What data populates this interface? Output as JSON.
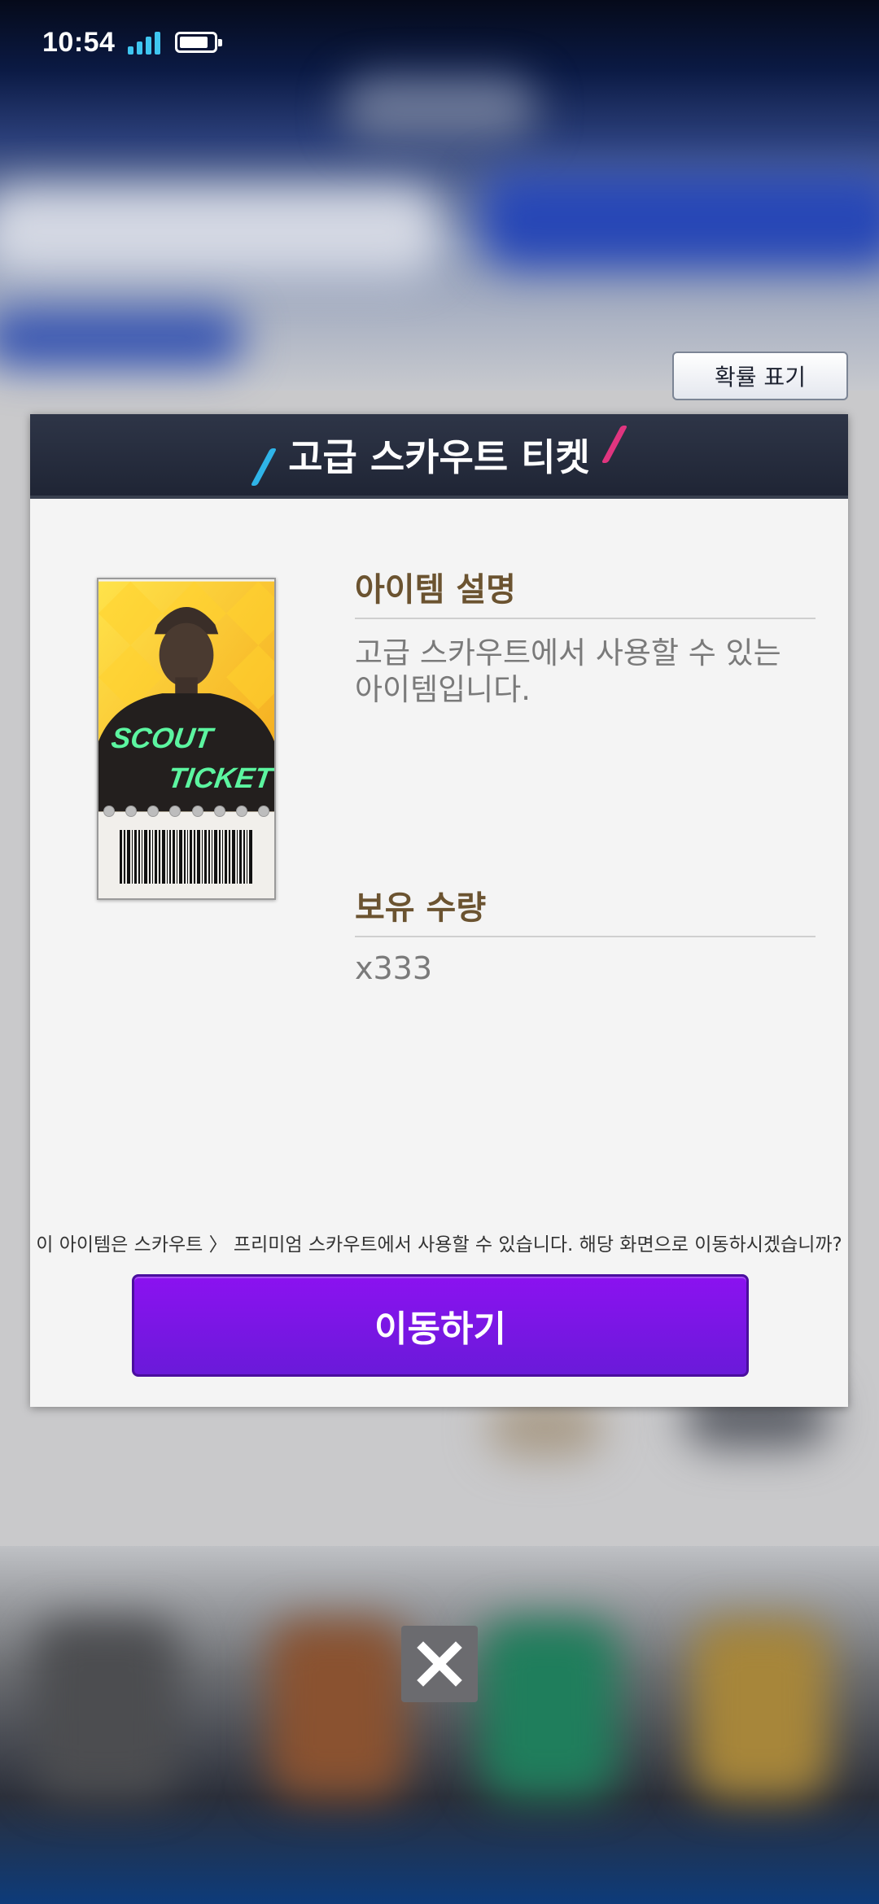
{
  "status_bar": {
    "time": "10:54"
  },
  "toolbar": {
    "probability_label": "확률 표기"
  },
  "dialog": {
    "title": "고급 스카우트 티켓",
    "item": {
      "art_text_line1": "SCOUT",
      "art_text_line2": "TICKET",
      "description_heading": "아이템 설명",
      "description": "고급 스카우트에서 사용할 수 있는 아이템입니다.",
      "quantity_heading": "보유 수량",
      "quantity": "x333"
    },
    "notice": "이 아이템은 스카우트 〉 프리미엄 스카우트에서 사용할 수 있습니다. 해당 화면으로 이동하시겠습니까?",
    "move_button_label": "이동하기"
  },
  "colors": {
    "header_bg": "#262c3d",
    "heading_brown": "#6b5330",
    "button_purple": "#7b14e6",
    "accent_blue": "#2fb4e8",
    "accent_pink": "#e0357f"
  },
  "icons": [
    "signal-icon",
    "battery-icon",
    "close-icon"
  ]
}
